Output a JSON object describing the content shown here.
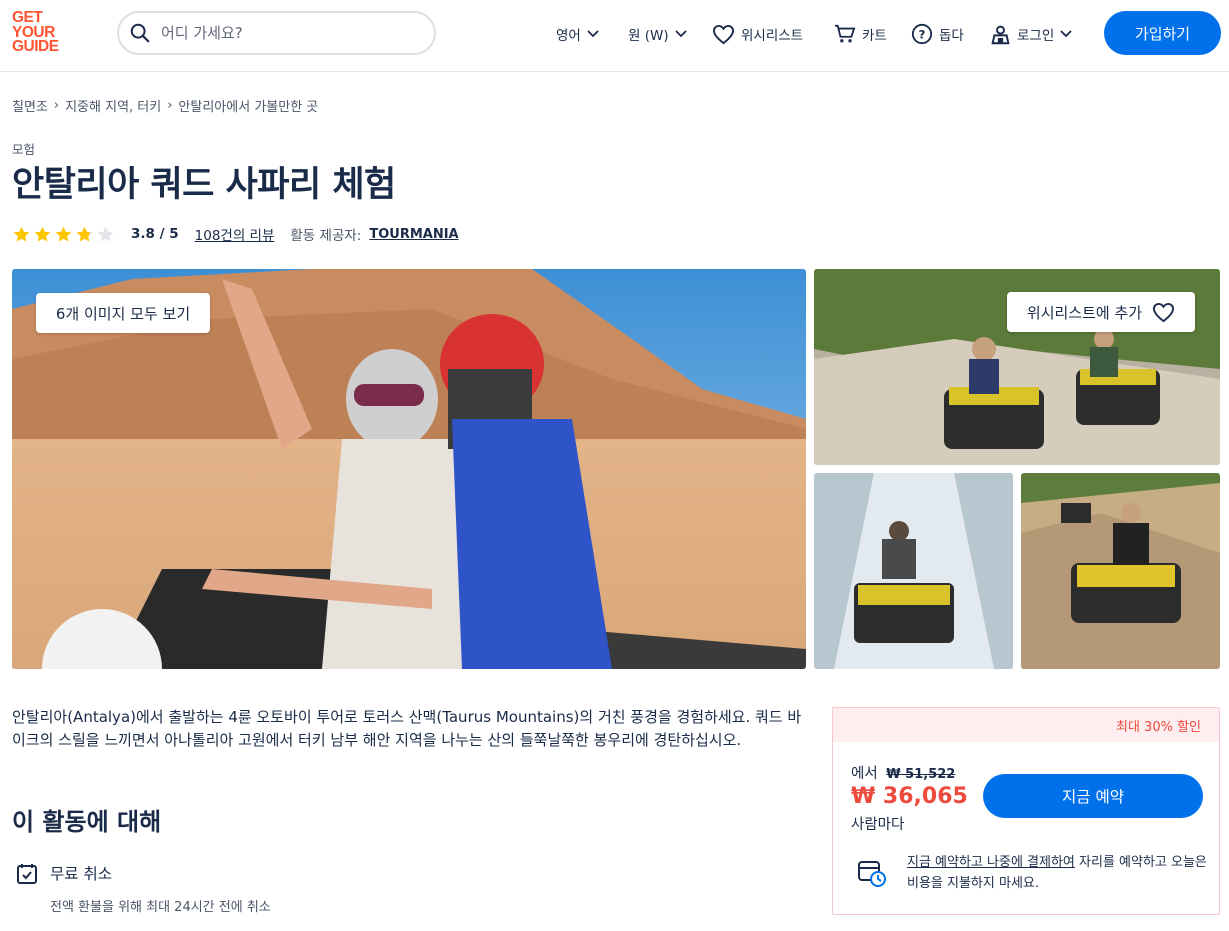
{
  "brand": {
    "logo_lines": [
      "GET",
      "YOUR",
      "GUIDE"
    ],
    "color": "#ff5533"
  },
  "header": {
    "search_placeholder": "어디 가세요?",
    "language": "영어",
    "currency": "원 (W)",
    "wishlist": "위시리스트",
    "cart": "카트",
    "help": "돕다",
    "login": "로그인",
    "signup": "가입하기",
    "accent": "#0071eb"
  },
  "breadcrumb": [
    "칠면조",
    "지중해 지역, 터키",
    "안탈리아에서 가볼만한 곳"
  ],
  "activity": {
    "category": "모험",
    "title": "안탈리아 쿼드 사파리 체험",
    "rating": 3.8,
    "rating_text": "3.8 / 5",
    "reviews": "108건의 리뷰",
    "provider_label": "활동 제공자:",
    "provider": "TOURMANIA"
  },
  "gallery": {
    "see_all": "6개 이미지 모두 보기",
    "add_wishlist": "위시리스트에 추가"
  },
  "description": "안탈리아(Antalya)에서 출발하는 4륜 오토바이 투어로 토러스 산맥(Taurus Mountains)의 거친 풍경을 경험하세요. 쿼드 바이크의 스릴을 느끼면서 아나톨리아 고원에서 터키 남부 해안 지역을 나누는 산의 들쭉날쭉한 봉우리에 경탄하십시오.",
  "about": {
    "heading": "이 활동에 대해",
    "features": [
      {
        "title": "무료 취소",
        "subtitle": "전액 환불을 위해 최대 24시간 전에 취소"
      }
    ]
  },
  "booking": {
    "discount": "최대 30% 할인",
    "from_label": "에서",
    "old_price": "₩ 51,522",
    "price": "₩ 36,065",
    "per": "사람마다",
    "book_button": "지금 예약",
    "rnpl_link": "지금 예약하고 나중에 결제하여",
    "rnpl_text": " 자리를 예약하고 오늘은 비용을 지불하지 마세요.",
    "price_color": "#eb4a3d"
  }
}
